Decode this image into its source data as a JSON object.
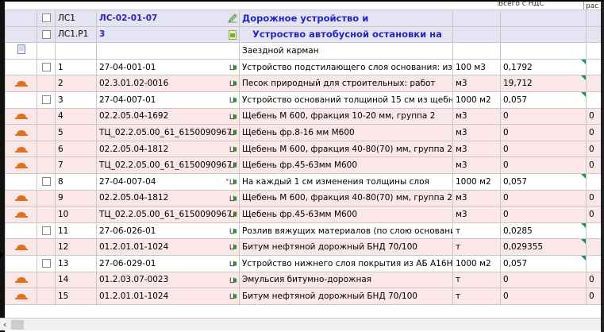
{
  "header_strip": {
    "col1": "Всего с НДС",
    "col2": "рас"
  },
  "section": {
    "level": "ЛС1",
    "code": "ЛС-02-01-07",
    "title": "Дорожное устройство и"
  },
  "subsection": {
    "level": "ЛС1.Р1",
    "code": "3",
    "title": "Устроство автобусной остановки на"
  },
  "group_row": {
    "name": "Заездной карман"
  },
  "rows": [
    {
      "n": "1",
      "code": "27-04-001-01",
      "name": "Устройство подстилающего слоя основания: из",
      "unit": "100 м3",
      "qty": "0,1792",
      "extra": "",
      "type": "work",
      "icon": "formula"
    },
    {
      "n": "2",
      "code": "02.3.01.02-0016",
      "name": "Песок природный для строительных: работ",
      "unit": "м3",
      "qty": "19,712",
      "extra": "",
      "type": "material",
      "icon": "formula"
    },
    {
      "n": "3",
      "code": "27-04-007-01",
      "name": "Устройство оснований толщиной 15 см из щебня",
      "unit": "1000 м2",
      "qty": "0,057",
      "extra": "",
      "type": "work",
      "icon": "formula"
    },
    {
      "n": "4",
      "code": "02.2.05.04-1692",
      "name": "Щебень М 600, фракция 10-20 мм, группа 2",
      "unit": "м3",
      "qty": "0",
      "extra": "0",
      "type": "material",
      "icon": "formula"
    },
    {
      "n": "5",
      "code": "ТЦ_02.2.05.00_61_6150090967",
      "name": "Щебень фр.8-16 мм М600",
      "unit": "м3",
      "qty": "0",
      "extra": "0",
      "type": "material",
      "icon": "formula-x"
    },
    {
      "n": "6",
      "code": "02.2.05.04-1812",
      "name": "Щебень М 600, фракция 40-80(70) мм, группа 2",
      "unit": "м3",
      "qty": "0",
      "extra": "0",
      "type": "material",
      "icon": "formula"
    },
    {
      "n": "7",
      "code": "ТЦ_02.2.05.00_61_6150090967",
      "name": "Щебень фр.45-63мм М600",
      "unit": "м3",
      "qty": "0",
      "extra": "0",
      "type": "material",
      "icon": "formula-x"
    },
    {
      "n": "8",
      "code": "27-04-007-04",
      "name": "На каждый 1 см изменения толщины слоя",
      "unit": "1000 м2",
      "qty": "0,057",
      "extra": "",
      "type": "work",
      "icon": "formula-plus"
    },
    {
      "n": "9",
      "code": "02.2.05.04-1812",
      "name": "Щебень М 600, фракция 40-80(70) мм, группа 2",
      "unit": "м3",
      "qty": "0",
      "extra": "0",
      "type": "material",
      "icon": "formula"
    },
    {
      "n": "10",
      "code": "ТЦ_02.2.05.00_61_6150090967",
      "name": "Щебень фр.45-63мм М600",
      "unit": "м3",
      "qty": "0",
      "extra": "0",
      "type": "material",
      "icon": "formula-x"
    },
    {
      "n": "11",
      "code": "27-06-026-01",
      "name": "Розлив вяжущих материалов (по слою основания",
      "unit": "т",
      "qty": "0,0285",
      "extra": "",
      "type": "work",
      "icon": "formula"
    },
    {
      "n": "12",
      "code": "01.2.01.01-1024",
      "name": "Битум нефтяной дорожный БНД 70/100",
      "unit": "т",
      "qty": "0,029355",
      "extra": "",
      "type": "material",
      "icon": "formula"
    },
    {
      "n": "13",
      "code": "27-06-029-01",
      "name": "Устройство нижнего слоя покрытия из АБ А16НН",
      "unit": "1000 м2",
      "qty": "0,057",
      "extra": "",
      "type": "work",
      "icon": "formula"
    },
    {
      "n": "14",
      "code": "01.2.03.07-0023",
      "name": "Эмульсия битумно-дорожная",
      "unit": "т",
      "qty": "0",
      "extra": "0",
      "type": "material",
      "icon": "formula"
    },
    {
      "n": "15",
      "code": "01.2.01.01-1024",
      "name": "Битум нефтяной дорожный БНД 70/100",
      "unit": "т",
      "qty": "0",
      "extra": "0",
      "type": "material",
      "icon": "formula"
    }
  ],
  "colors": {
    "section_text": "#2525c4",
    "section_bg": "#e4e4f2",
    "material_bg": "#fbe7e7",
    "marker_green": "#1a9a3a",
    "hat_orange": "#e07020"
  }
}
